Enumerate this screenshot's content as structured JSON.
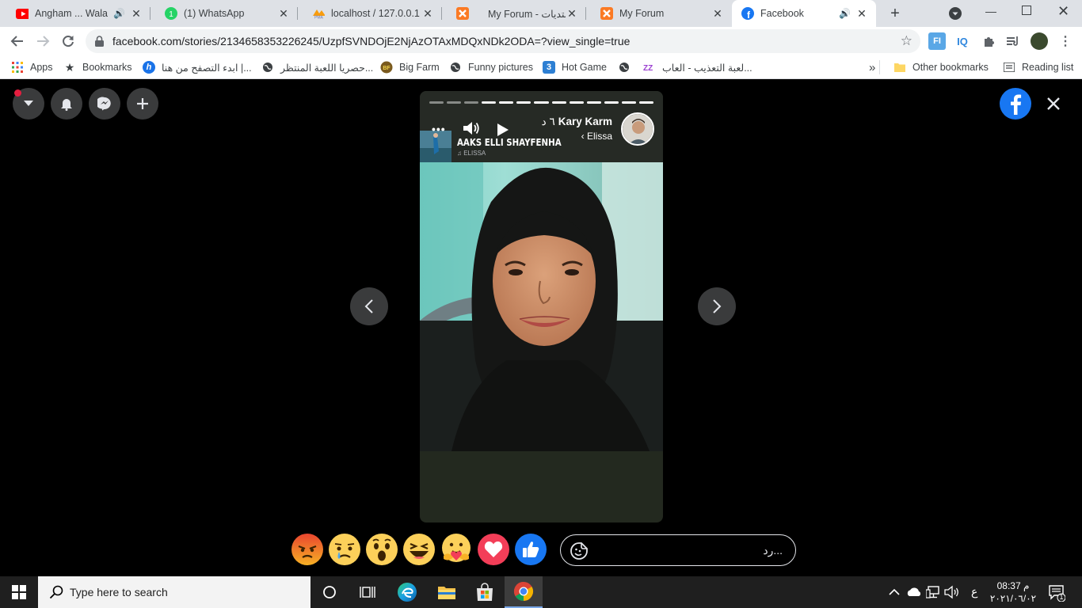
{
  "tabs": [
    {
      "title": "Angham ... Wala D",
      "favicon": "youtube-icon",
      "audio": true
    },
    {
      "title": "(1) WhatsApp",
      "favicon": "whatsapp-icon",
      "audio": false
    },
    {
      "title": "localhost / 127.0.0.1 /",
      "favicon": "phpmyadmin-icon",
      "audio": false
    },
    {
      "title": "My Forum - منتديات",
      "favicon": "xampp-icon",
      "audio": false
    },
    {
      "title": "My Forum",
      "favicon": "xampp-icon",
      "audio": false
    },
    {
      "title": "Facebook",
      "favicon": "facebook-icon",
      "audio": true,
      "active": true
    }
  ],
  "omnibox": {
    "url": "facebook.com/stories/2134658353226245/UzpfSVNDOjE2NjAzOTAxMDQxNDk2ODA=?view_single=true"
  },
  "bookmarks": {
    "items": [
      "Apps",
      "Bookmarks",
      "ابدء التصفح من هنا |...",
      "حصريا اللعبة المنتظر...",
      "Big Farm",
      "Funny pictures",
      "Hot Game",
      "",
      "لعبة التعذيب - العاب..."
    ],
    "more": "»",
    "other": "Other bookmarks",
    "reading": "Reading list"
  },
  "story": {
    "author": "Kary Karm",
    "time": "٦ د",
    "music_artist": "Elissa",
    "song_title": "AAKS ELLI SHAYFENHA",
    "song_artist_small": "♫ ELISSA",
    "more": "•••",
    "progress": {
      "segments": 13,
      "viewed": 3,
      "current": 4
    }
  },
  "reactions": [
    "angry",
    "sad",
    "wow",
    "haha",
    "care",
    "love",
    "like"
  ],
  "reply": {
    "placeholder": "رد..."
  },
  "taskbar": {
    "search_placeholder": "Type here to search",
    "time": "08:37 م",
    "date": "٢٠٢١/٠٦/٠٢",
    "lang": "ع",
    "notif_count": "1"
  },
  "colors": {
    "fb_blue": "#1877f2",
    "tab_bg": "#dee1e6",
    "story_bg": "#23291f"
  }
}
